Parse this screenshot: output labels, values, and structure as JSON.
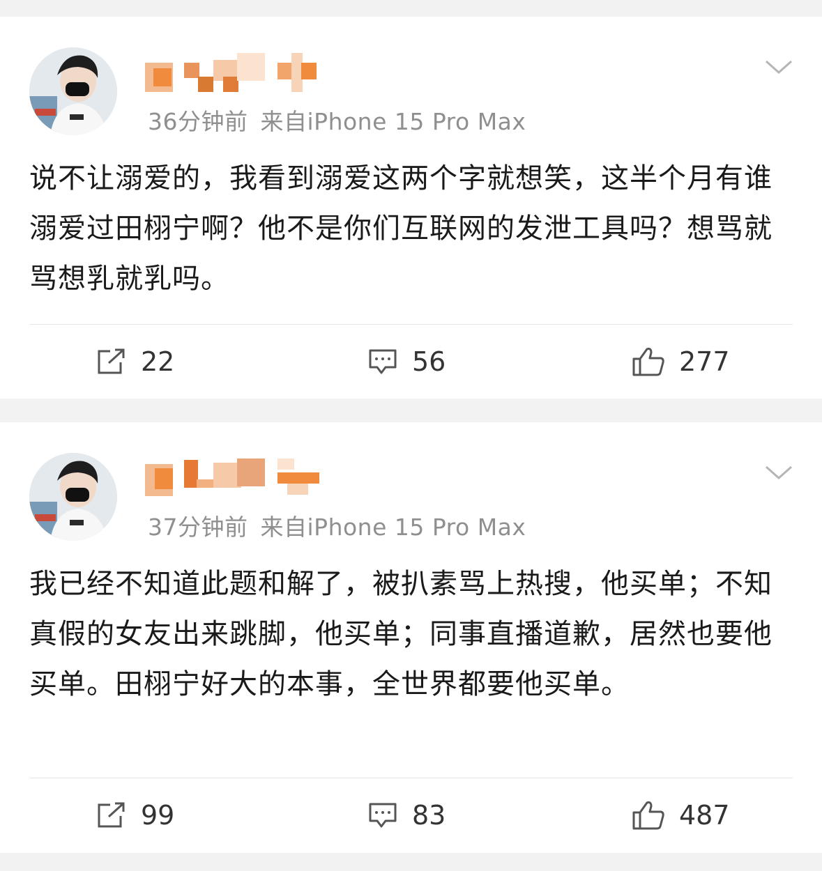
{
  "posts": [
    {
      "time": "36分钟前",
      "source": "来自iPhone 15 Pro Max",
      "text": "说不让溺爱的，我看到溺爱这两个字就想笑，这半个月有谁溺爱过田栩宁啊？他不是你们互联网的发泄工具吗？想骂就骂想乳就乳吗。",
      "repost_count": "22",
      "comment_count": "56",
      "like_count": "277"
    },
    {
      "time": "37分钟前",
      "source": "来自iPhone 15 Pro Max",
      "text": "我已经不知道此题和解了，被扒素骂上热搜，他买单；不知真假的女友出来跳脚，他买单；同事直播道歉，居然也要他买单。田栩宁好大的本事，全世界都要他买单。",
      "repost_count": "99",
      "comment_count": "83",
      "like_count": "487"
    }
  ],
  "icons": {
    "repost": "repost-icon",
    "comment": "comment-icon",
    "like": "thumbs-up-icon",
    "more": "chevron-down-icon"
  },
  "colors": {
    "background": "#f2f2f2",
    "card": "#ffffff",
    "meta_text": "#8f8f8f",
    "body_text": "#1a1a1a",
    "blur_orange": "#f08a3c"
  }
}
